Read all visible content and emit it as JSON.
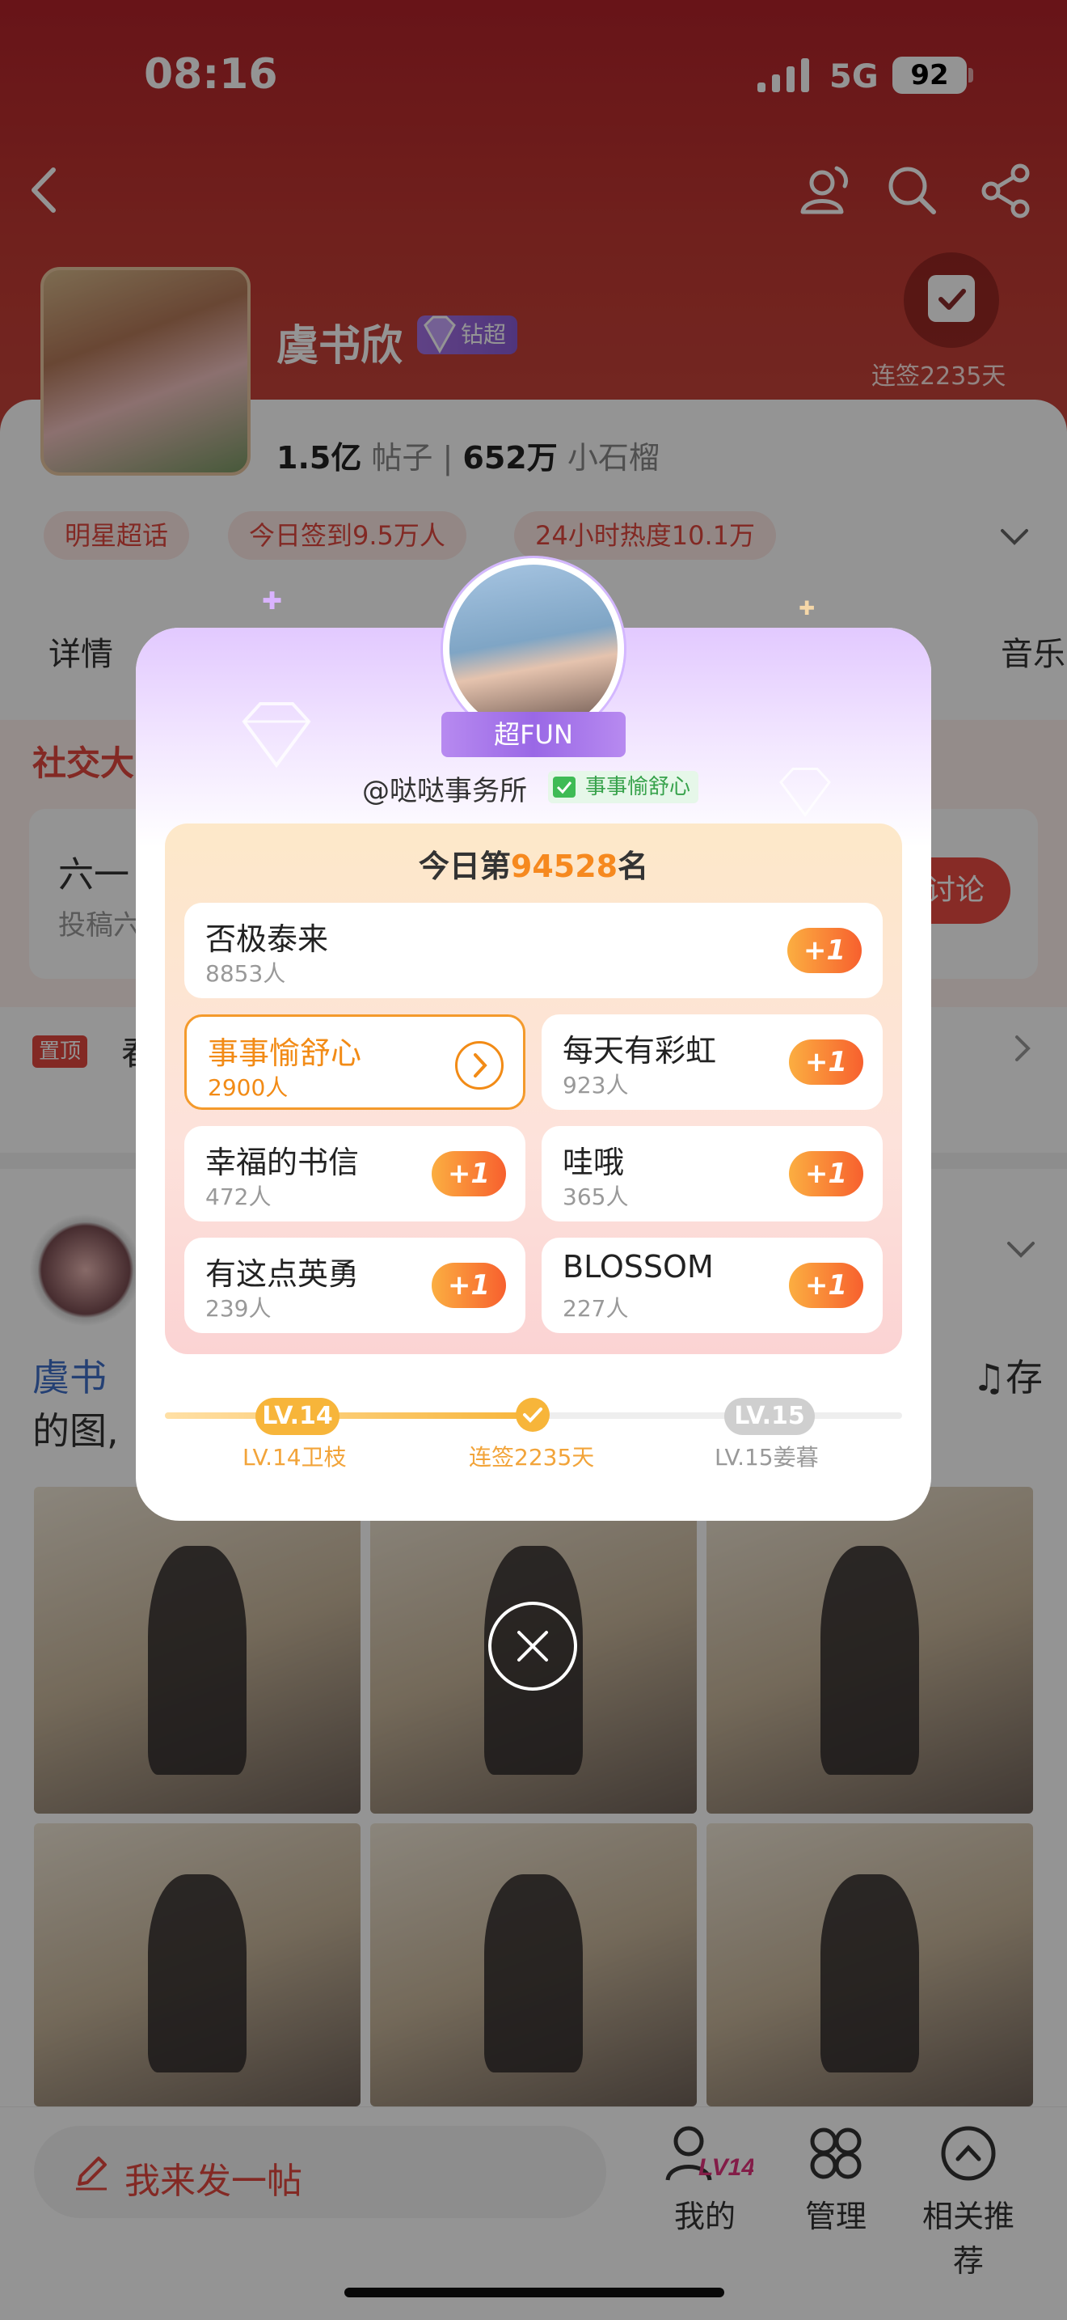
{
  "status_bar": {
    "time": "08:16",
    "network": "5G",
    "battery": "92"
  },
  "profile": {
    "name": "虞书欣",
    "badge": "钻超",
    "signin_days": "连签2235天",
    "posts_count": "1.5亿",
    "posts_label": "帖子",
    "fans_count": "652万",
    "fans_label": "小石榴"
  },
  "tags": [
    "明星超话",
    "今日签到9.5万人",
    "24小时热度10.1万"
  ],
  "tabs": {
    "first": "详情",
    "last": "音乐"
  },
  "social": {
    "label": "社交大",
    "topic_title": "六一",
    "topic_sub": "投稿六",
    "button": "讨论"
  },
  "pinned": {
    "badge": "置顶",
    "text": "春"
  },
  "post": {
    "text_line1_prefix": "虞书",
    "text_line1_suffix": "♫存",
    "text_line2": "的图,"
  },
  "bottom_bar": {
    "post_placeholder": "我来发一帖",
    "nav": [
      {
        "label": "我的",
        "badge": "LV14"
      },
      {
        "label": "管理"
      },
      {
        "label": "相关推荐"
      }
    ]
  },
  "modal": {
    "badge": "超FUN",
    "handle": "@哒哒事务所",
    "mood": "事事愉舒心",
    "rank_prefix": "今日第",
    "rank_number": "94528",
    "rank_suffix": "名",
    "moods": [
      {
        "title": "否极泰来",
        "count": "8853人",
        "action": "+1"
      },
      {
        "title": "事事愉舒心",
        "count": "2900人",
        "selected": true
      },
      {
        "title": "每天有彩虹",
        "count": "923人",
        "action": "+1"
      },
      {
        "title": "幸福的书信",
        "count": "472人",
        "action": "+1"
      },
      {
        "title": "哇哦",
        "count": "365人",
        "action": "+1"
      },
      {
        "title": "有这点英勇",
        "count": "239人",
        "action": "+1"
      },
      {
        "title": "BLOSSOM",
        "count": "227人",
        "action": "+1"
      }
    ],
    "progress": {
      "current_level": "LV.14",
      "current_label": "LV.14卫枝",
      "streak_label": "连签2235天",
      "next_level": "LV.15",
      "next_label": "LV.15姜暮",
      "fraction": 0.5
    }
  },
  "colors": {
    "header": "#b3232a",
    "accent": "#e2483f",
    "orange": "#f6891f",
    "purple": "#9a68e6"
  }
}
